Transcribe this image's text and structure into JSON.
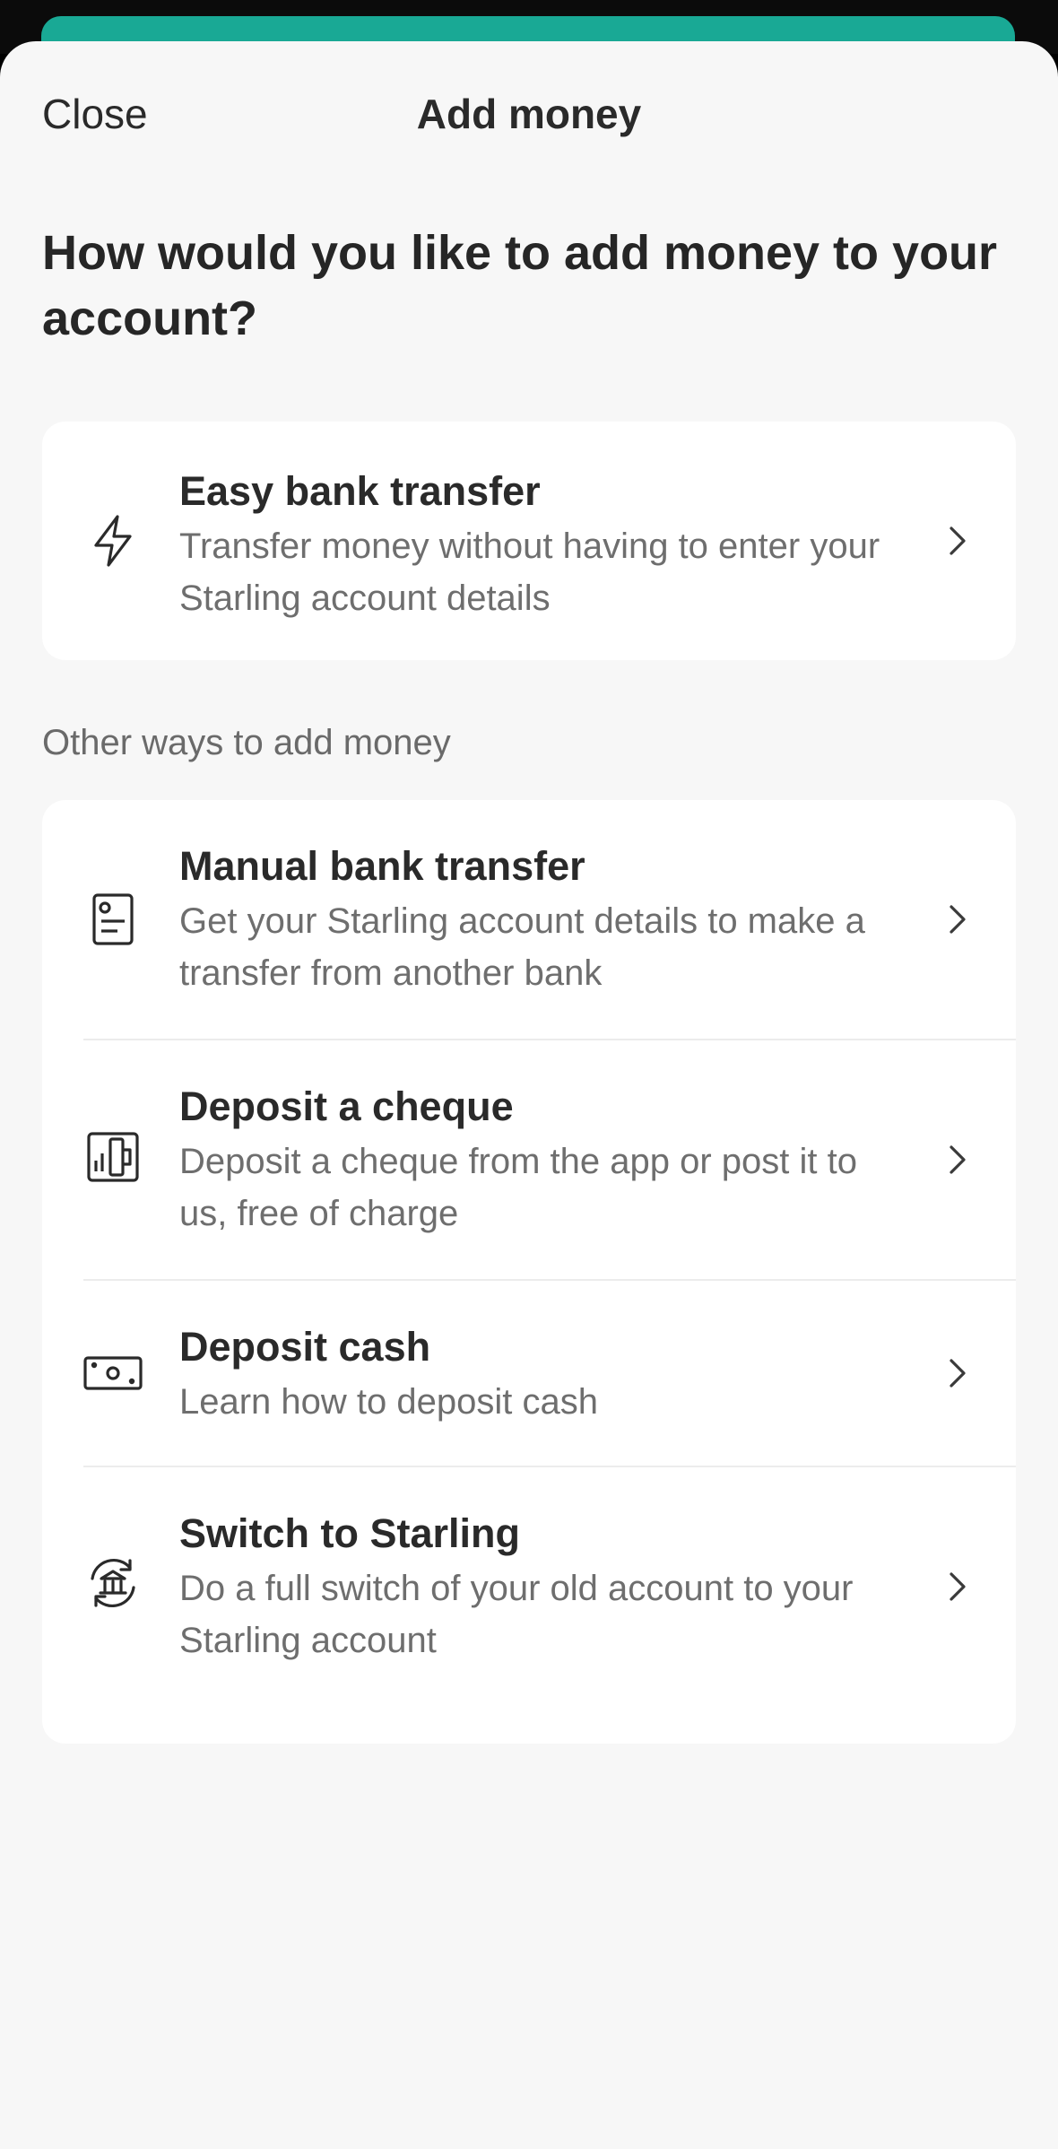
{
  "colors": {
    "accent": "#19a995",
    "sheet_bg": "#f7f7f7",
    "card_bg": "#ffffff"
  },
  "header": {
    "close_label": "Close",
    "title": "Add money"
  },
  "question": "How would you like to add money to your account?",
  "easy": {
    "title": "Easy bank transfer",
    "description": "Transfer money without having to enter your Starling account details",
    "icon": "lightning-icon"
  },
  "other_label": "Other ways to add money",
  "options": [
    {
      "title": "Manual bank transfer",
      "description": "Get your Starling account details to make a transfer from another bank",
      "icon": "account-details-icon"
    },
    {
      "title": "Deposit a cheque",
      "description": "Deposit a cheque from the app or post it to us, free of charge",
      "icon": "cheque-icon"
    },
    {
      "title": "Deposit cash",
      "description": "Learn how to deposit cash",
      "icon": "cash-icon"
    },
    {
      "title": "Switch to Starling",
      "description": "Do a full switch of your old account to your Starling account",
      "icon": "bank-switch-icon"
    }
  ]
}
